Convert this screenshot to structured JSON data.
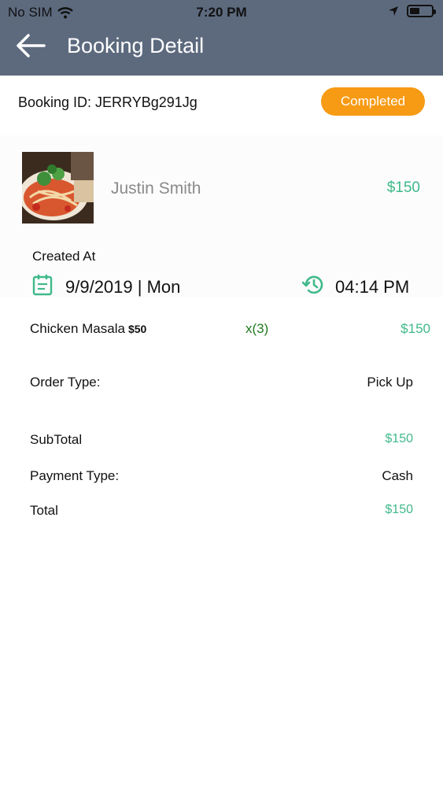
{
  "status_bar": {
    "carrier": "No SIM",
    "time": "7:20 PM"
  },
  "header": {
    "title": "Booking Detail"
  },
  "booking": {
    "id_label": "Booking ID: JERRYBg291Jg",
    "status": "Completed"
  },
  "card": {
    "customer_name": "Justin Smith",
    "price": "$150",
    "created_label": "Created At",
    "date": "9/9/2019 | Mon",
    "time": "04:14 PM"
  },
  "items": [
    {
      "name": "Chicken Masala",
      "unit_price": "$50",
      "qty": "x(3)",
      "total": "$150"
    }
  ],
  "summary": {
    "order_type_label": "Order Type:",
    "order_type_value": "Pick Up",
    "subtotal_label": "SubTotal",
    "subtotal_value": "$150",
    "payment_type_label": "Payment Type:",
    "payment_type_value": "Cash",
    "total_label": "Total",
    "total_value": "$150"
  },
  "colors": {
    "header_bg": "#5d6a7e",
    "status_badge": "#f79a14",
    "money_green": "#3fb98a",
    "icon_teal": "#3fb98a",
    "qty_green": "#1f7a1f"
  }
}
